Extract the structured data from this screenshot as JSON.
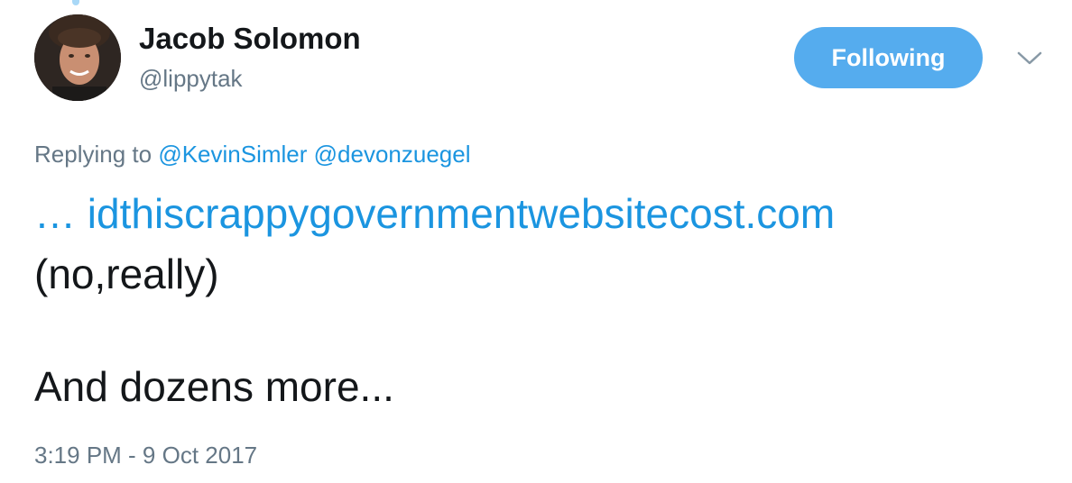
{
  "tweet": {
    "author": {
      "name": "Jacob Solomon",
      "handle": "@lippytak",
      "avatar_icon": "profile-photo"
    },
    "follow_button": {
      "label": "Following",
      "color": "#55acee"
    },
    "menu_icon": "chevron-down-icon",
    "reply_context": {
      "prefix": "Replying to",
      "mentions": [
        "@KevinSimler",
        "@devonzuegel"
      ]
    },
    "body": {
      "link_prefix": "…",
      "link_text": "idthiscrappygovernmentwebsitecost.com",
      "line2": "(no,really)",
      "line3": "And dozens more..."
    },
    "timestamp": "3:19 PM - 9 Oct 2017"
  },
  "colors": {
    "link": "#1b95e0",
    "text": "#14171a",
    "secondary": "#657786",
    "button": "#55acee"
  }
}
